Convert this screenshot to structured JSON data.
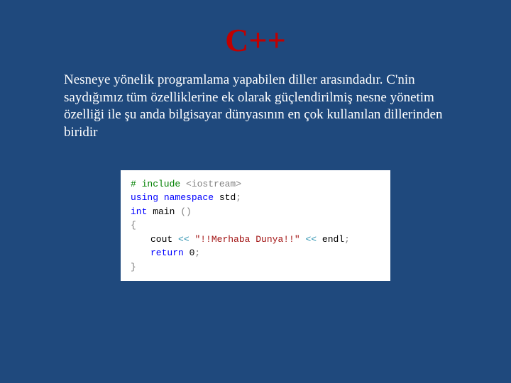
{
  "slide": {
    "title": "C++",
    "body": "Nesneye yönelik programlama yapabilen diller arasındadır. C'nin saydığımız tüm özelliklerine ek olarak güçlendirilmiş nesne yönetim özelliği ile şu anda bilgisayar dünyasının en çok kullanılan dillerinden biridir"
  },
  "code": {
    "l1_a": "# include ",
    "l1_b": "<iostream>",
    "l2_a": "using",
    "l2_b": " ",
    "l2_c": "namespace",
    "l2_d": " std",
    "l2_e": ";",
    "l3": "",
    "l4_a": "int",
    "l4_b": " main ",
    "l4_c": "()",
    "l5": "",
    "l6": "{",
    "l7_a": "cout ",
    "l7_b": "<<",
    "l7_c": " ",
    "l7_d": "\"!!Merhaba Dunya!!\"",
    "l7_e": " ",
    "l7_f": "<<",
    "l7_g": " endl",
    "l7_h": ";",
    "l8_a": "return",
    "l8_b": " 0",
    "l8_c": ";",
    "l9": "}"
  }
}
